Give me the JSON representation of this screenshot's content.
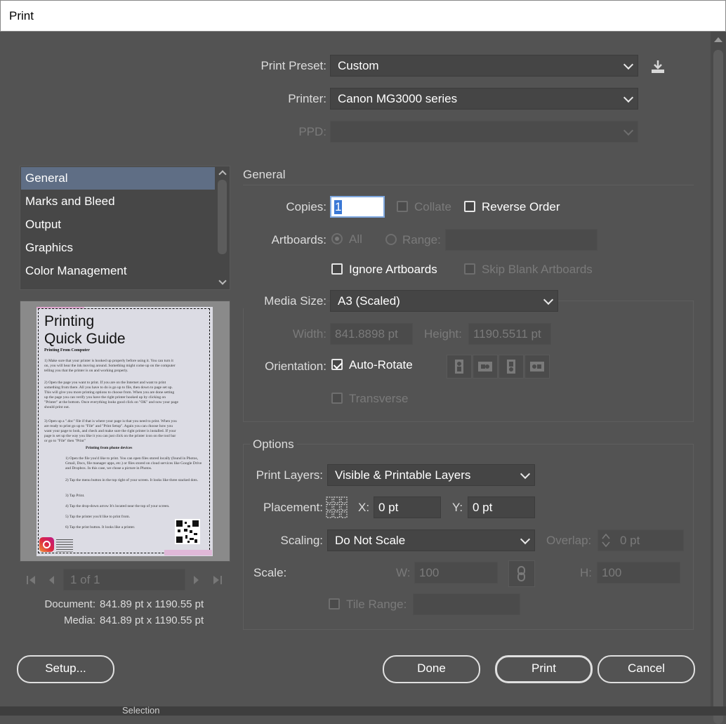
{
  "window": {
    "title": "Print"
  },
  "top": {
    "preset_label": "Print Preset:",
    "preset_value": "Custom",
    "printer_label": "Printer:",
    "printer_value": "Canon MG3000 series",
    "ppd_label": "PPD:"
  },
  "sidebar": {
    "items": [
      {
        "label": "General"
      },
      {
        "label": "Marks and Bleed"
      },
      {
        "label": "Output"
      },
      {
        "label": "Graphics"
      },
      {
        "label": "Color Management"
      }
    ]
  },
  "preview": {
    "doc_title_1": "Printing",
    "doc_title_2": "Quick Guide",
    "doc_subtitle": "Printing From Computer",
    "doc_p1": "1) Make sure that your printer is hooked up properly before using it. You can turn it on, you will hear the ink moving around. Something might come up on the computer telling you that the printer is on and working properly.",
    "doc_p2": "2) Open the page you want to print. If you are on the Internet and want to print something from there. All you have to do is go up to file, then down to page set up. This will give you more printing options to choose from. When you are done setting up the page you can verify you have the right printer hooked up by clicking on \"Printer\" at the bottom. Once everything looks good click on \"OK\" and now your page should print out.",
    "doc_p3": "3) Open up a \".doc\" file if that is where your page is that you need to print. When you are ready to print go up to \"File\" and \"Print Setup\". Again you can choose how you want your page to look, and check and make sure the right printer is installed. If your page is set up the way you like it you can just click on the printer icon on the tool bar or go to \"File\" then \"Print\"",
    "doc_subtitle2": "Printing from phone devices",
    "doc_q1": "1) Open the file you'd like to print. You can open files stored locally (found in Photos, Gmail, Docs, file manager apps, etc.) or files stored on cloud services like Google Drive and Dropbox. In this case, we chose a picture in Photos.",
    "doc_q2": "2) Tap the menu button in the top right of your screen. It looks like three stacked dots.",
    "doc_q3": "3) Tap Print.",
    "doc_q4": "4) Tap the drop-down arrow It's located near the top of your screen.",
    "doc_q5": "5) Tap the printer you'd like to print from.",
    "doc_q6": "6) Tap the print button. It looks like a printer.",
    "page_indicator": "1 of 1",
    "document_label": "Document:",
    "document_value": "841.89 pt x 1190.55 pt",
    "media_label": "Media:",
    "media_value": "841.89 pt x 1190.55 pt"
  },
  "general": {
    "section_title": "General",
    "copies_label": "Copies:",
    "copies_value": "1",
    "collate_label": "Collate",
    "reverse_label": "Reverse Order",
    "artboards_label": "Artboards:",
    "all_label": "All",
    "range_label": "Range:",
    "ignore_label": "Ignore Artboards",
    "skip_label": "Skip Blank Artboards",
    "media_size_label": "Media Size:",
    "media_size_value": "A3 (Scaled)",
    "width_label": "Width:",
    "width_value": "841.8898 pt",
    "height_label": "Height:",
    "height_value": "1190.5511 pt",
    "orientation_label": "Orientation:",
    "autorotate_label": "Auto-Rotate",
    "transverse_label": "Transverse"
  },
  "options": {
    "section_title": "Options",
    "layers_label": "Print Layers:",
    "layers_value": "Visible & Printable Layers",
    "placement_label": "Placement:",
    "x_label": "X:",
    "x_value": "0 pt",
    "y_label": "Y:",
    "y_value": "0 pt",
    "scaling_label": "Scaling:",
    "scaling_value": "Do Not Scale",
    "overlap_label": "Overlap:",
    "overlap_value": "0 pt",
    "scale_label": "Scale:",
    "w_label": "W:",
    "w_value": "100",
    "h_label": "H:",
    "h_value": "100",
    "tile_label": "Tile Range:"
  },
  "buttons": {
    "setup": "Setup...",
    "done": "Done",
    "print": "Print",
    "cancel": "Cancel"
  },
  "underlay": {
    "selection_text": "Selection"
  },
  "colors": {
    "accent": "#5f6e85",
    "background": "#535353",
    "field": "#454545"
  }
}
